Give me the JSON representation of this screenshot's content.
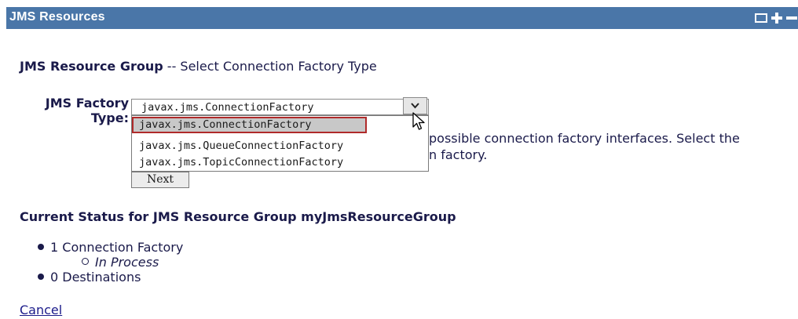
{
  "panel": {
    "title": "JMS Resources"
  },
  "heading": {
    "bold": "JMS Resource Group",
    "rest": " -- Select Connection Factory Type"
  },
  "form": {
    "factory_label_line1": "JMS Factory",
    "factory_label_line2": "Type:",
    "selected_value": "javax.jms.ConnectionFactory",
    "options": [
      "javax.jms.ConnectionFactory",
      "javax.jms.QueueConnectionFactory",
      "javax.jms.TopicConnectionFactory"
    ],
    "description_line1": "possible connection factory interfaces. Select the",
    "description_line2": "n factory.",
    "next_label": "Next"
  },
  "status": {
    "heading": "Current Status for JMS Resource Group myJmsResourceGroup",
    "items": [
      {
        "label": "1 Connection Factory",
        "sub": "In Process"
      },
      {
        "label": "0 Destinations"
      }
    ]
  },
  "cancel_label": "Cancel",
  "colors": {
    "titlebar": "#4a76a8",
    "highlight_border": "#b02a2a",
    "text": "#1a1a4a"
  }
}
